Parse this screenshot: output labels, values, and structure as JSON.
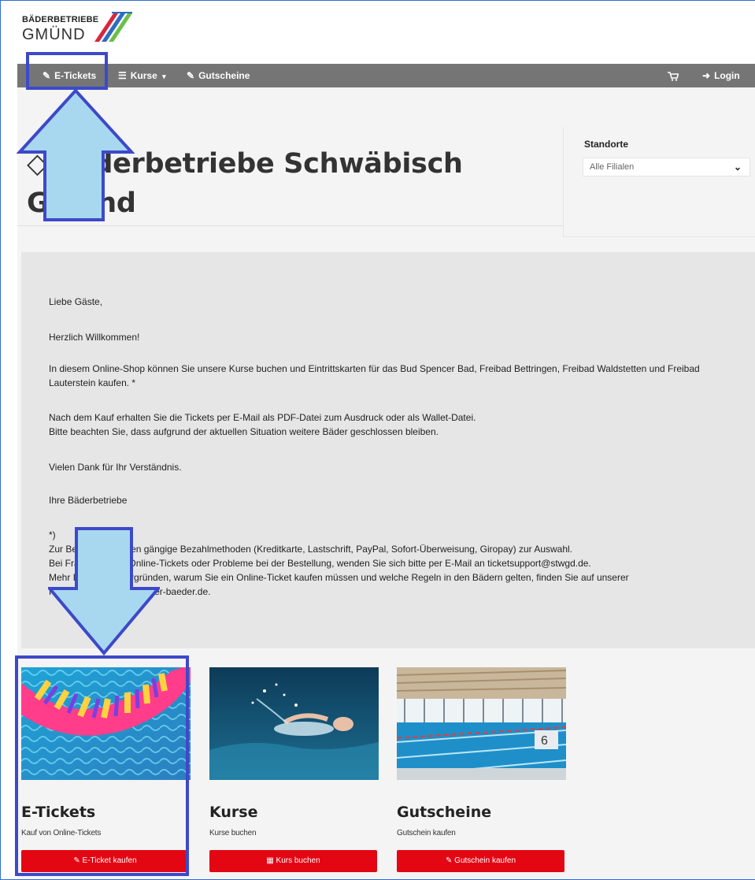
{
  "header": {
    "logo_line1": "BÄDERBETRIEBE",
    "logo_line2": "GMÜND"
  },
  "navbar": {
    "items": [
      {
        "label": "E-Tickets",
        "icon": "ticket-icon"
      },
      {
        "label": "Kurse",
        "icon": "list-icon",
        "caret": "▾"
      },
      {
        "label": "Gutscheine",
        "icon": "ticket-icon"
      }
    ],
    "cart_icon": "cart-icon",
    "login_label": "Login",
    "login_icon": "sign-in-icon"
  },
  "page": {
    "title": "Bäderbetriebe Schwäbisch Gmünd"
  },
  "standorte": {
    "label": "Standorte",
    "selected": "Alle Filialen"
  },
  "welcome": {
    "lines": [
      "Liebe Gäste,",
      "Herzlich Willkommen!",
      "In diesem Online-Shop können Sie unsere Kurse buchen und Eintrittskarten für das Bud Spencer Bad, Freibad Bettringen, Freibad Waldstetten und Freibad Lauterstein kaufen. *",
      "Nach dem Kauf erhalten Sie die Tickets per E-Mail als PDF-Datei zum Ausdruck oder als Wallet-Datei.",
      "Bitte beachten Sie, dass aufgrund der aktuellen Situation weitere Bäder geschlossen bleiben.",
      "Vielen Dank für Ihr Verständnis.",
      "Ihre Bäderbetriebe",
      "*)",
      "Zur Bezahlung stehen gängige Bezahlmethoden (Kreditkarte, Lastschrift, PayPal, Sofort-Überweisung, Giropay) zur Auswahl.",
      "Bei Fragen zu den Online-Tickets oder Probleme bei der Bestellung, wenden Sie sich bitte per E-Mail an ticketsupport@stwgd.de.",
      "Mehr Infos zu Hintergründen, warum Sie ein Online-Ticket kaufen müssen und welche Regeln in den Bädern gelten, finden Sie auf unserer",
      "Homepage www.gmuender-baeder.de."
    ]
  },
  "cards": [
    {
      "title": "E-Tickets",
      "subtitle": "Kauf von Online-Tickets",
      "button": "E-Ticket kaufen",
      "button_icon": "ticket-icon"
    },
    {
      "title": "Kurse",
      "subtitle": "Kurse buchen",
      "button": "Kurs buchen",
      "button_icon": "list-icon"
    },
    {
      "title": "Gutscheine",
      "subtitle": "Gutschein kaufen",
      "button": "Gutschein kaufen",
      "button_icon": "ticket-icon"
    }
  ],
  "colors": {
    "navbar": "#757575",
    "accent_red": "#e30613",
    "annotation_blue": "#3d49c9",
    "annotation_fill": "#a8d8ef"
  }
}
